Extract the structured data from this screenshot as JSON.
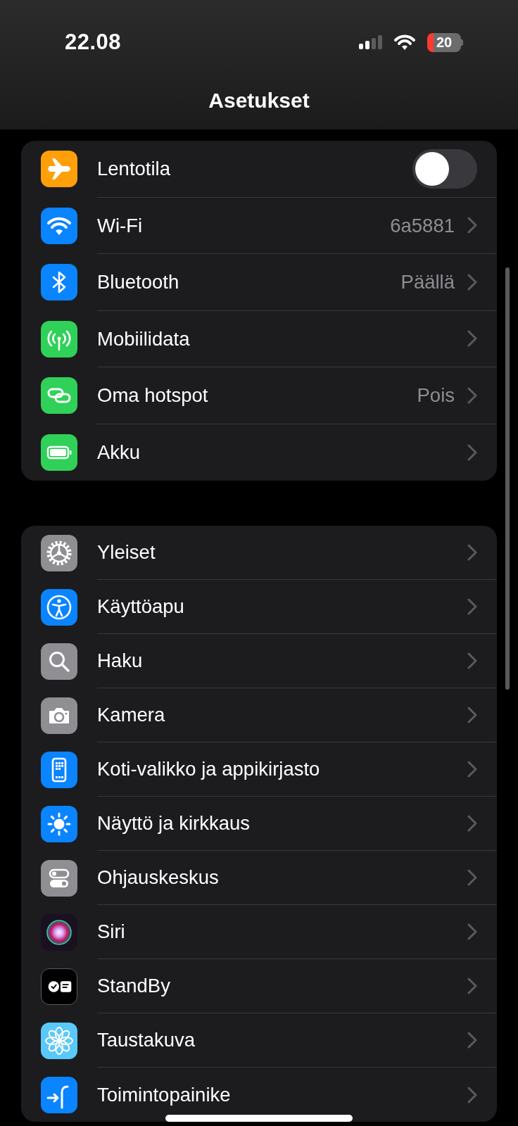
{
  "status_bar": {
    "time": "22.08",
    "battery": "20"
  },
  "title": "Asetukset",
  "groups": [
    {
      "items": [
        {
          "kind": "toggle",
          "label": "Lentotila",
          "on": false,
          "color": "#ff9f0a"
        },
        {
          "kind": "link",
          "label": "Wi-Fi",
          "value": "6a5881",
          "color": "#0a84ff"
        },
        {
          "kind": "link",
          "label": "Bluetooth",
          "value": "Päällä",
          "color": "#0a84ff"
        },
        {
          "kind": "link",
          "label": "Mobiilidata",
          "color": "#30d158"
        },
        {
          "kind": "link",
          "label": "Oma hotspot",
          "value": "Pois",
          "color": "#30d158"
        },
        {
          "kind": "link",
          "label": "Akku",
          "color": "#30d158"
        }
      ]
    },
    {
      "items": [
        {
          "kind": "link",
          "label": "Yleiset",
          "color": "#8e8e93"
        },
        {
          "kind": "link",
          "label": "Käyttöapu",
          "color": "#0a84ff"
        },
        {
          "kind": "link",
          "label": "Haku",
          "color": "#8e8e93"
        },
        {
          "kind": "link",
          "label": "Kamera",
          "color": "#8e8e93"
        },
        {
          "kind": "link",
          "label": "Koti-valikko ja appikirjasto",
          "color": "#0a84ff"
        },
        {
          "kind": "link",
          "label": "Näyttö ja kirkkaus",
          "color": "#0a84ff"
        },
        {
          "kind": "link",
          "label": "Ohjauskeskus",
          "color": "#8e8e93"
        },
        {
          "kind": "link",
          "label": "Siri",
          "color": "#1a1020"
        },
        {
          "kind": "link",
          "label": "StandBy",
          "color": "#000000"
        },
        {
          "kind": "link",
          "label": "Taustakuva",
          "color": "#5ac8fa"
        },
        {
          "kind": "link",
          "label": "Toimintopainike",
          "color": "#0a84ff"
        }
      ]
    }
  ]
}
